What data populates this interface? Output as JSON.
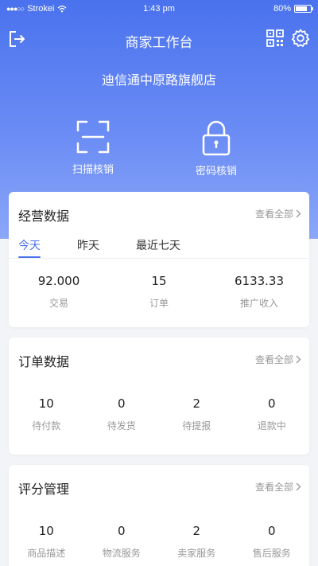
{
  "status_bar": {
    "signal_dots": "●●●○○",
    "carrier": "Strokei",
    "wifi_icon": "wifi-icon",
    "time": "1:43 pm",
    "battery_percent": "80%",
    "battery_level": 0.8
  },
  "header": {
    "title": "商家工作台",
    "logout_icon": "logout-icon",
    "qr_icon": "qr-code-icon",
    "settings_icon": "gear-icon"
  },
  "store": {
    "name": "迪信通中原路旗舰店"
  },
  "actions": [
    {
      "icon": "scan-icon",
      "label": "扫描核销"
    },
    {
      "icon": "lock-icon",
      "label": "密码核销"
    }
  ],
  "business": {
    "title": "经营数据",
    "view_all": "查看全部",
    "tabs": [
      {
        "label": "今天",
        "active": true
      },
      {
        "label": "昨天",
        "active": false
      },
      {
        "label": "最近七天",
        "active": false
      }
    ],
    "stats": [
      {
        "value": "92.000",
        "label": "交易"
      },
      {
        "value": "15",
        "label": "订单"
      },
      {
        "value": "6133.33",
        "label": "推广收入"
      }
    ]
  },
  "orders": {
    "title": "订单数据",
    "view_all": "查看全部",
    "stats": [
      {
        "value": "10",
        "label": "待付款"
      },
      {
        "value": "0",
        "label": "待发货"
      },
      {
        "value": "2",
        "label": "待提报"
      },
      {
        "value": "0",
        "label": "退款中"
      }
    ]
  },
  "ratings": {
    "title": "评分管理",
    "view_all": "查看全部",
    "stats": [
      {
        "value": "10",
        "label": "商品描述"
      },
      {
        "value": "0",
        "label": "物流服务"
      },
      {
        "value": "2",
        "label": "卖家服务"
      },
      {
        "value": "0",
        "label": "售后服务"
      }
    ]
  },
  "colors": {
    "accent": "#4a72ee",
    "hero_top": "#4a72ee",
    "hero_bottom": "#8ba7f8",
    "background": "#f3f4f8",
    "muted_text": "#999999"
  }
}
